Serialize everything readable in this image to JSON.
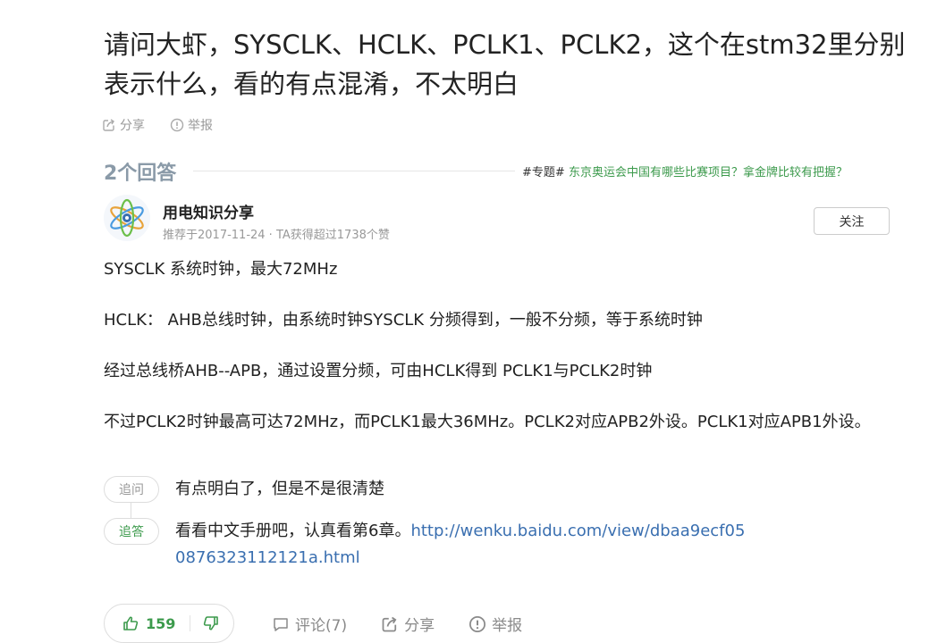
{
  "question": {
    "title": "请问大虾，SYSCLK、HCLK、PCLK1、PCLK2，这个在stm32里分别表示什么，看的有点混淆，不太明白",
    "share_label": "分享",
    "report_label": "举报"
  },
  "answers_header": {
    "count_label": "2个回答",
    "topic_prefix": "#专题#",
    "topic_link": "东京奥运会中国有哪些比赛项目？拿金牌比较有把握？"
  },
  "answer": {
    "author": "用电知识分享",
    "meta": "推荐于2017-11-24 · TA获得超过1738个赞",
    "follow_label": "关注",
    "paragraphs": [
      "SYSCLK 系统时钟，最大72MHz",
      "HCLK： AHB总线时钟，由系统时钟SYSCLK 分频得到，一般不分频，等于系统时钟",
      "经过总线桥AHB--APB，通过设置分频，可由HCLK得到 PCLK1与PCLK2时钟",
      "不过PCLK2时钟最高可达72MHz，而PCLK1最大36MHz。PCLK2对应APB2外设。PCLK1对应APB1外设。"
    ],
    "followups": [
      {
        "tag": "追问",
        "text": "有点明白了，但是不是很清楚"
      },
      {
        "tag": "追答",
        "text": "看看中文手册吧，认真看第6章。",
        "link_line1": "http://wenku.baidu.com/view/dbaa9ecf05",
        "link_line2": "0876323112121a.html"
      }
    ],
    "likes": "159",
    "comment_label": "评论(7)",
    "share_label": "分享",
    "report_label": "举报"
  },
  "colors": {
    "accent_green": "#3c9a4c",
    "link_blue": "#3a6fb0",
    "muted": "#999999"
  },
  "icons": [
    "share-icon",
    "report-icon",
    "avatar-atom-icon",
    "thumbs-up-icon",
    "thumbs-down-icon",
    "comment-icon"
  ]
}
